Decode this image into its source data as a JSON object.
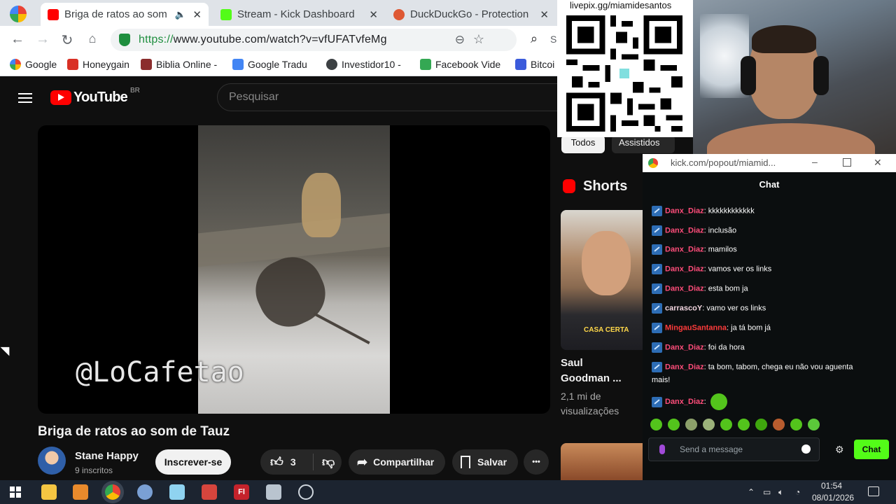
{
  "browser": {
    "tabs": [
      {
        "title": "Briga de ratos ao som",
        "active": true
      },
      {
        "title": "Stream - Kick Dashboard",
        "active": false
      },
      {
        "title": "DuckDuckGo - Protection",
        "active": false
      }
    ],
    "tab_close": "✕",
    "url_https": "https://",
    "url_rest": "www.youtube.com/watch?v=vfUFATvfeMg",
    "search_partial": "S",
    "bookmarks": [
      "Google",
      "Honeygain",
      "Biblia Online -",
      "Google Tradu",
      "Investidor10 -",
      "Facebook Vide",
      "Bitcoi"
    ]
  },
  "youtube": {
    "logo_text": "YouTube",
    "region": "BR",
    "search_placeholder": "Pesquisar",
    "watermark": "@LoCafetao",
    "video_title": "Briga de ratos ao som de Tauz",
    "channel_name": "Stane Happy",
    "subscribers": "9 inscritos",
    "subscribe_label": "Inscrever-se",
    "likes": "3",
    "share_label": "Compartilhar",
    "save_label": "Salvar",
    "more_label": "•••"
  },
  "side": {
    "chips": [
      "Todos",
      "Assistidos"
    ],
    "shorts_label": "Shorts",
    "short_caption": "CASA CERTA",
    "short_title_1": "Saul",
    "short_title_2": "Goodman ...",
    "short_views_1": "2,1 mi de",
    "short_views_2": "visualizações"
  },
  "overlay": {
    "livepix": "livepix.gg/miamidesantos"
  },
  "kick": {
    "popout_url": "kick.com/popout/miamid...",
    "header": "Chat",
    "messages": [
      {
        "user": "Danx_Diaz",
        "text": ": kkkkkkkkkkkk"
      },
      {
        "user": "Danx_Diaz",
        "text": ": inclusão"
      },
      {
        "user": "Danx_Diaz",
        "text": ": mamilos"
      },
      {
        "user": "Danx_Diaz",
        "text": ": vamos ver os links"
      },
      {
        "user": "Danx_Diaz",
        "text": ": esta bom ja"
      },
      {
        "user": "carrascoY",
        "text": ": vamo ver os links"
      },
      {
        "user": "MingauSantanna",
        "text": ": ja tá bom já"
      },
      {
        "user": "Danx_Diaz",
        "text": ": foi da hora"
      },
      {
        "user": "Danx_Diaz",
        "text": ": ta bom, tabom, chega eu não vou aguenta"
      },
      {
        "user": "Danx_Diaz",
        "text": ":"
      }
    ],
    "wrap_line": "mais!",
    "send_placeholder": "Send a message",
    "chat_button": "Chat",
    "colors": {
      "accent": "#53fc18",
      "user": "#ff4d7a",
      "badge": "#2d6db5"
    }
  },
  "taskbar": {
    "time": "01:54",
    "date": "08/01/2026"
  }
}
